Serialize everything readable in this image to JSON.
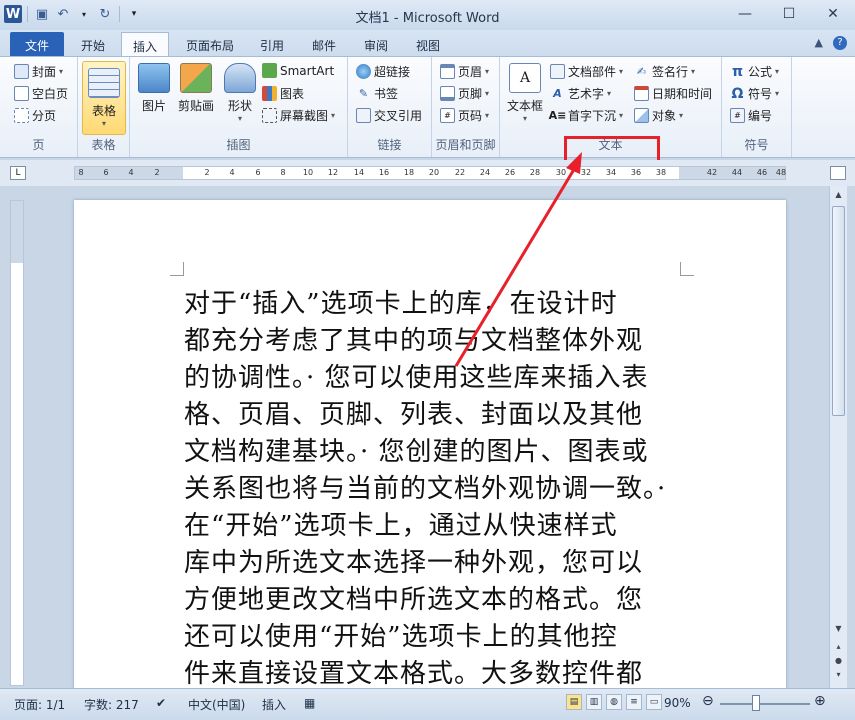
{
  "window": {
    "title": "文档1 - Microsoft Word",
    "logo": "W",
    "controls": {
      "minimize": "—",
      "maximize": "☐",
      "close": "✕"
    }
  },
  "tabs": [
    "文件",
    "开始",
    "插入",
    "页面布局",
    "引用",
    "邮件",
    "审阅",
    "视图"
  ],
  "active_tab": "插入",
  "ribbon": {
    "pages": {
      "label": "页",
      "items": [
        "封面",
        "空白页",
        "分页"
      ]
    },
    "tables": {
      "label": "表格",
      "item": "表格"
    },
    "illustrations": {
      "label": "插图",
      "items": [
        "图片",
        "剪贴画",
        "形状"
      ],
      "small": [
        "SmartArt",
        "图表",
        "屏幕截图"
      ]
    },
    "links": {
      "label": "链接",
      "items": [
        "超链接",
        "书签",
        "交叉引用"
      ]
    },
    "header_footer": {
      "label": "页眉和页脚",
      "items": [
        "页眉",
        "页脚",
        "页码"
      ]
    },
    "text": {
      "label": "文本",
      "textbox": "文本框",
      "items": [
        "文档部件",
        "艺术字",
        "首字下沉"
      ],
      "items2": [
        "签名行",
        "日期和时间",
        "对象"
      ]
    },
    "symbols": {
      "label": "符号",
      "items": [
        "公式",
        "符号",
        "编号"
      ]
    }
  },
  "ruler": {
    "ticks": [
      "8",
      "6",
      "4",
      "2",
      "2",
      "4",
      "6",
      "8",
      "10",
      "12",
      "14",
      "16",
      "18",
      "20",
      "22",
      "24",
      "26",
      "28",
      "30",
      "32",
      "34",
      "36",
      "38",
      "42",
      "44",
      "46",
      "48"
    ]
  },
  "document": {
    "lines": [
      "对于“插入”选项卡上的库，在设计时",
      "都充分考虑了其中的项与文档整体外观",
      "的协调性。· 您可以使用这些库来插入表",
      "格、页眉、页脚、列表、封面以及其他",
      "文档构建基块。· 您创建的图片、图表或",
      "关系图也将与当前的文档外观协调一致。·",
      "在“开始”选项卡上，通过从快速样式",
      "库中为所选文本选择一种外观，您可以",
      "方便地更改文档中所选文本的格式。您",
      "还可以使用“开始”选项卡上的其他控",
      "件来直接设置文本格式。大多数控件都"
    ]
  },
  "status": {
    "page": "页面: 1/1",
    "words": "字数: 217",
    "language": "中文(中国)",
    "mode": "插入",
    "zoom": "90%"
  },
  "colors": {
    "annotation": "#e8202a",
    "file_tab": "#2a62b7"
  }
}
